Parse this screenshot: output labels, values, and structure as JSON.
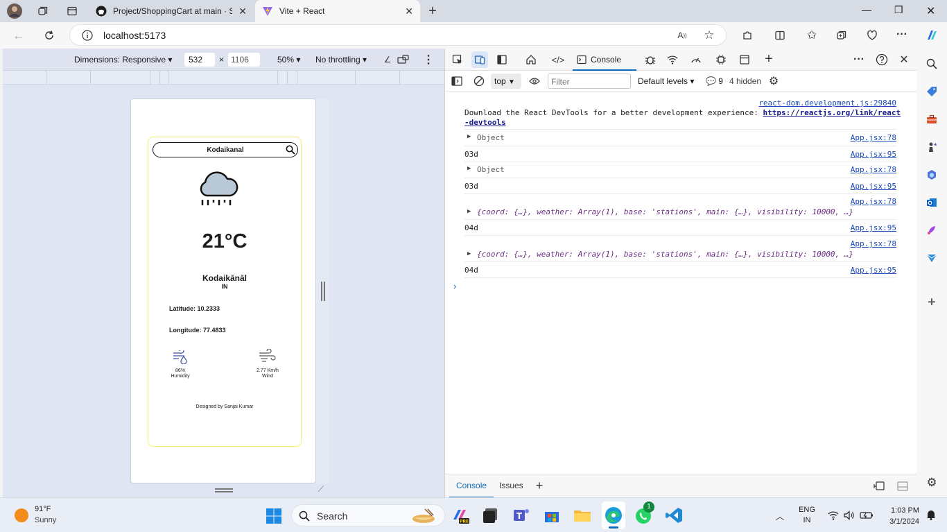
{
  "browser": {
    "tabs": [
      {
        "title": "Project/ShoppingCart at main · S",
        "active": false
      },
      {
        "title": "Vite + React",
        "active": true
      }
    ],
    "url": "localhost:5173"
  },
  "emulation": {
    "dimensions_label": "Dimensions: Responsive",
    "width": "532",
    "times": "×",
    "height": "1106",
    "zoom": "50%",
    "throttle": "No throttling"
  },
  "app": {
    "search_value": "Kodaikanal",
    "temperature": "21°C",
    "city": "Kodaikānāl",
    "country": "IN",
    "latitude_label": "Latitude: 10.2333",
    "longitude_label": "Longitude: 77.4833",
    "humidity_value": "86%",
    "humidity_label": "Humidity",
    "wind_value": "2.77 Km/h",
    "wind_label": "Wind",
    "footer": "Designed by Sanjai Kumar"
  },
  "devtools": {
    "console_tab": "Console",
    "context": "top",
    "filter_placeholder": "Filter",
    "levels": "Default levels",
    "message_count": "9",
    "hidden": "4 hidden",
    "react_source": "react-dom.development.js:29840",
    "react_msg": "Download the React DevTools for a better development experience: ",
    "react_link1": "https://reactjs.org/link/react",
    "react_link2": "-devtools",
    "obj": "Object",
    "code_03d": "03d",
    "code_04d": "04d",
    "src78": "App.jsx:78",
    "src95": "App.jsx:95",
    "obj_expanded": "{coord: {…}, weather: Array(1), base: 'stations', main: {…}, visibility: 10000, …}",
    "drawer_console": "Console",
    "drawer_issues": "Issues"
  },
  "taskbar": {
    "weather_temp": "91°F",
    "weather_desc": "Sunny",
    "search": "Search",
    "lang1": "ENG",
    "lang2": "IN",
    "time": "1:03 PM",
    "date": "3/1/2024",
    "badge": "1"
  }
}
